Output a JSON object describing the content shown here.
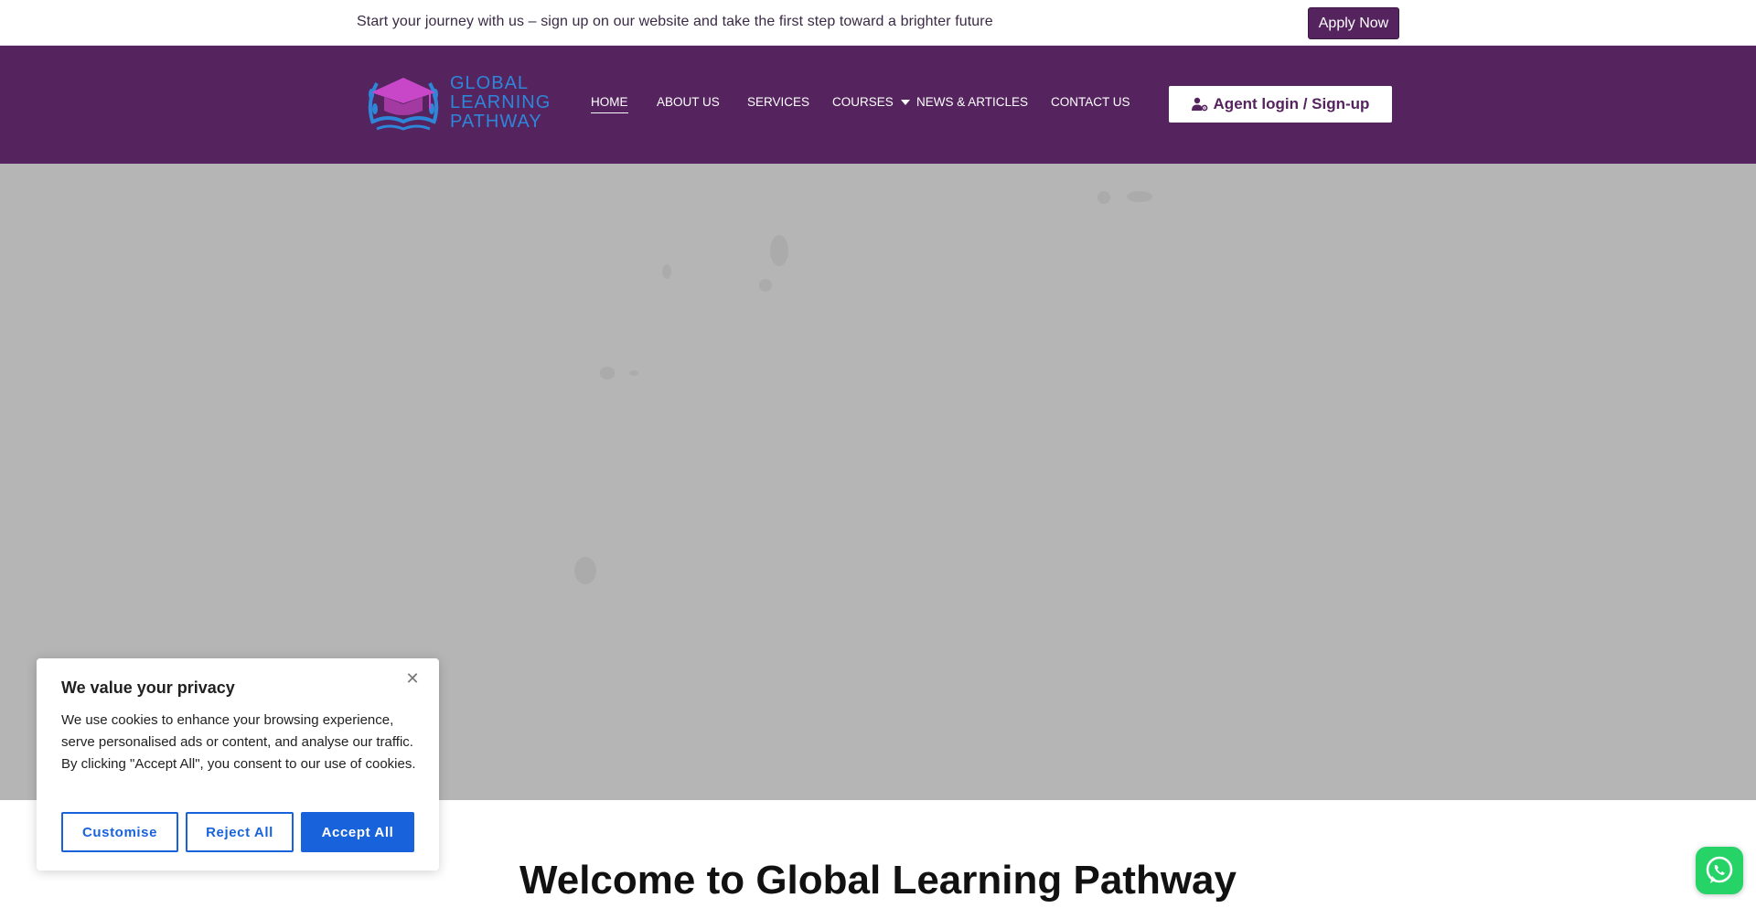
{
  "topbar": {
    "announcement": "Start your journey with us – sign up on our website and take the first step toward a brighter future",
    "apply_label": "Apply Now"
  },
  "header": {
    "logo_lines": [
      "GLOBAL",
      "LEARNING",
      "PATHWAY"
    ],
    "logo_icon": "graduation-cap-logo",
    "nav": [
      {
        "label": "HOME",
        "active": true
      },
      {
        "label": "ABOUT US"
      },
      {
        "label": "SERVICES"
      },
      {
        "label": "COURSES",
        "has_dropdown": true
      },
      {
        "label": "NEWS & ARTICLES"
      },
      {
        "label": "CONTACT US"
      }
    ],
    "agent_label": "Agent login / Sign-up",
    "agent_icon": "user-gear-icon"
  },
  "main": {
    "welcome_heading": "Welcome to Global Learning Pathway"
  },
  "cookie": {
    "title": "We value your privacy",
    "body": "We use cookies to enhance your browsing experience, serve personalised ads or content, and analyse our traffic. By clicking \"Accept All\", you consent to our use of cookies.",
    "close_icon": "close-icon",
    "customise_label": "Customise",
    "reject_label": "Reject All",
    "accept_label": "Accept All"
  },
  "whatsapp": {
    "icon": "whatsapp-icon"
  },
  "colors": {
    "brand_purple": "#55245e",
    "hero_overlay": "#b5b5b5",
    "cookie_blue": "#1863dc",
    "whatsapp_green": "#25d366"
  }
}
